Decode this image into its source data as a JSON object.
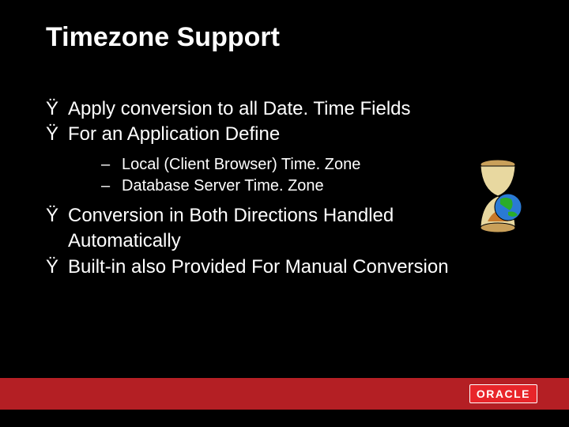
{
  "title": "Timezone Support",
  "bullets": {
    "b1": "Apply conversion to all Date. Time Fields",
    "b2": "For an Application Define",
    "s1": "Local (Client Browser) Time. Zone",
    "s2": "Database Server Time. Zone",
    "b3a": "Conversion in Both Directions Handled",
    "b3b": "Automatically",
    "b4": "Built-in also Provided For Manual Conversion"
  },
  "marks": {
    "main": "Ÿ",
    "sub": "–"
  },
  "logo": "ORACLE"
}
